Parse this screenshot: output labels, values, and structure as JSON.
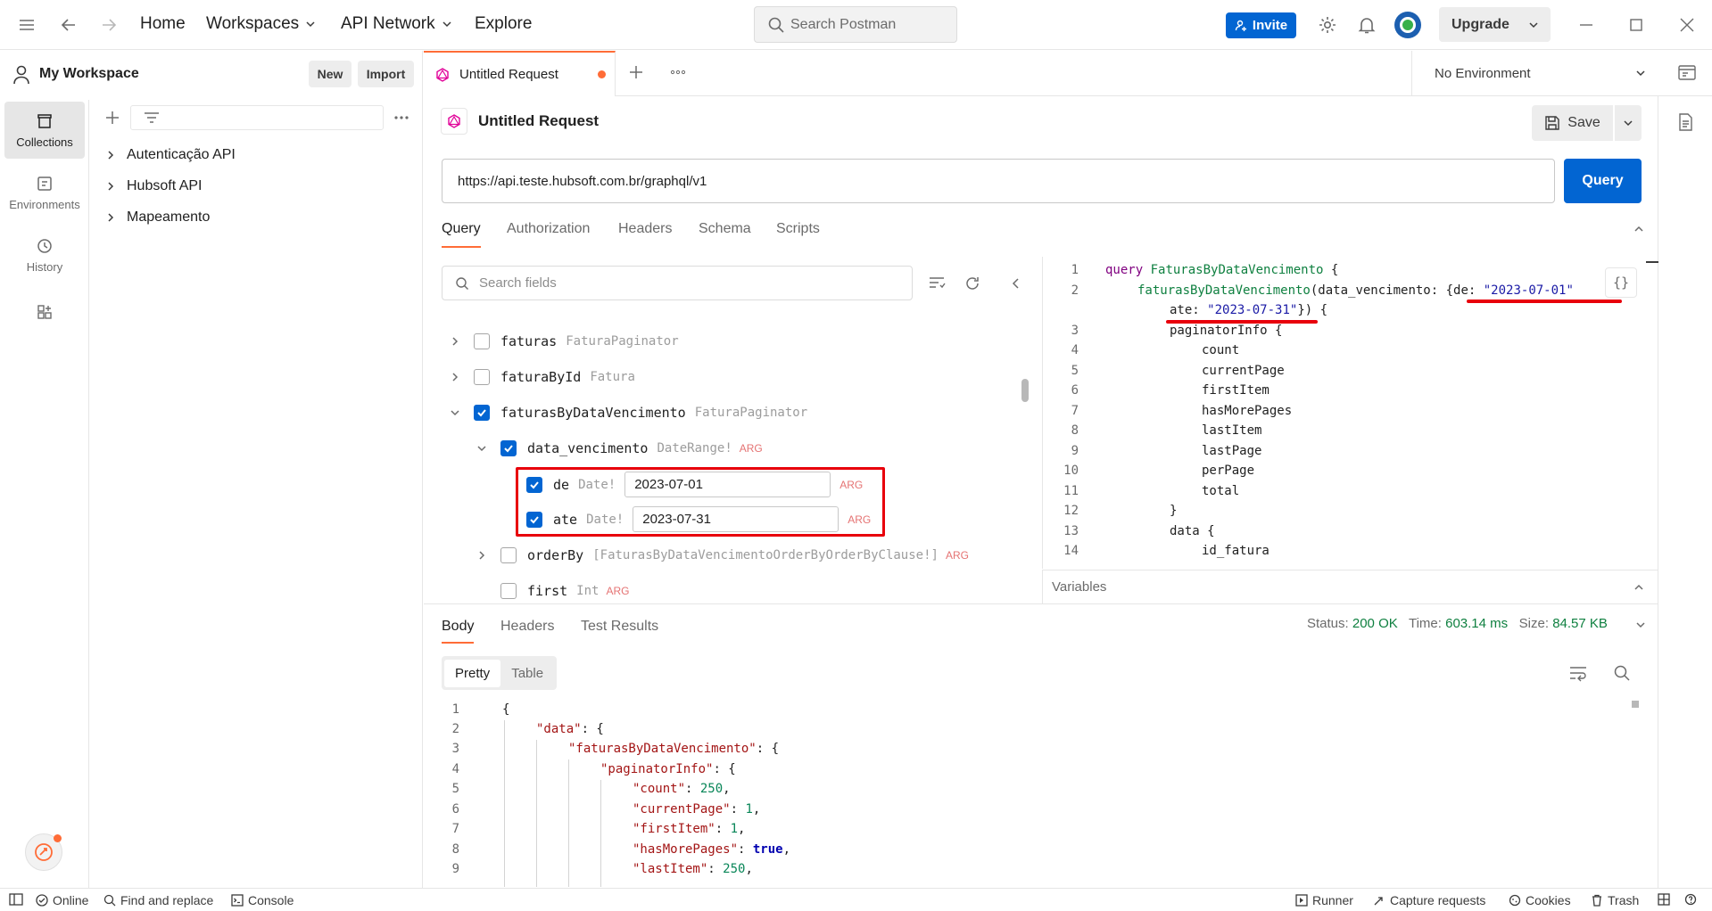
{
  "topbar": {
    "nav": {
      "home": "Home",
      "workspaces": "Workspaces",
      "api_network": "API Network",
      "explore": "Explore"
    },
    "search_placeholder": "Search Postman",
    "invite": "Invite",
    "upgrade": "Upgrade"
  },
  "workspace": {
    "name": "My Workspace",
    "new": "New",
    "import": "Import"
  },
  "rail": {
    "collections": "Collections",
    "environments": "Environments",
    "history": "History"
  },
  "collections": [
    "Autenticação API",
    "Hubsoft API",
    "Mapeamento"
  ],
  "tab": {
    "title": "Untitled Request",
    "unsaved_dot_color": "#ff6c37"
  },
  "environment": "No Environment",
  "request": {
    "title": "Untitled Request",
    "save": "Save",
    "url": "https://api.teste.hubsoft.com.br/graphql/v1",
    "query_button": "Query",
    "tabs": [
      "Query",
      "Authorization",
      "Headers",
      "Schema",
      "Scripts"
    ]
  },
  "explorer": {
    "search_placeholder": "Search fields",
    "fields": [
      {
        "name": "faturas",
        "type": "FaturaPaginator",
        "checked": false
      },
      {
        "name": "faturaById",
        "type": "Fatura",
        "checked": false
      },
      {
        "name": "faturasByDataVencimento",
        "type": "FaturaPaginator",
        "checked": true
      },
      {
        "name": "data_vencimento",
        "type": "DateRange!",
        "arg": "ARG",
        "checked": true
      },
      {
        "name": "de",
        "type": "Date!",
        "value": "2023-07-01",
        "arg": "ARG",
        "checked": true
      },
      {
        "name": "ate",
        "type": "Date!",
        "value": "2023-07-31",
        "arg": "ARG",
        "checked": true
      },
      {
        "name": "orderBy",
        "type": "[FaturasByDataVencimentoOrderByOrderByClause!]",
        "arg": "ARG",
        "checked": false
      },
      {
        "name": "first",
        "type": "Int",
        "arg": "ARG",
        "checked": false
      }
    ]
  },
  "editor": {
    "line_numbers": [
      "1",
      "2",
      "",
      "3",
      "4",
      "5",
      "6",
      "7",
      "8",
      "9",
      "10",
      "11",
      "12",
      "13",
      "14"
    ],
    "l1_kw": "query",
    "l1_name": "FaturasByDataVencimento",
    "l1_brace": " {",
    "l2_fn": "faturasByDataVencimento",
    "l2_mid": "(data_vencimento: {de: ",
    "l2_str": "\"2023-07-01\"",
    "l3_key": "ate: ",
    "l3_str": "\"2023-07-31\"",
    "l3_end": "}) {",
    "lines": [
      "paginatorInfo {",
      "count",
      "currentPage",
      "firstItem",
      "hasMorePages",
      "lastItem",
      "lastPage",
      "perPage",
      "total",
      "}",
      "data {",
      "id_fatura"
    ],
    "variables": "Variables"
  },
  "response": {
    "tabs": [
      "Body",
      "Headers",
      "Test Results"
    ],
    "status_label": "Status:",
    "status": "200 OK",
    "time_label": "Time:",
    "time": "603.14 ms",
    "size_label": "Size:",
    "size": "84.57 KB",
    "formats": [
      "Pretty",
      "Table"
    ],
    "line_numbers": [
      "1",
      "2",
      "3",
      "4",
      "5",
      "6",
      "7",
      "8",
      "9"
    ],
    "json": {
      "l1": "{",
      "data_key": "\"data\"",
      "fbdv_key": "\"faturasByDataVencimento\"",
      "pi_key": "\"paginatorInfo\"",
      "count_key": "\"count\"",
      "count_val": "250",
      "cp_key": "\"currentPage\"",
      "cp_val": "1",
      "fi_key": "\"firstItem\"",
      "fi_val": "1",
      "hmp_key": "\"hasMorePages\"",
      "hmp_val": "true",
      "li_key": "\"lastItem\"",
      "li_val": "250"
    }
  },
  "bottom": {
    "online": "Online",
    "find_replace": "Find and replace",
    "console": "Console",
    "runner": "Runner",
    "capture": "Capture requests",
    "cookies": "Cookies",
    "trash": "Trash"
  }
}
